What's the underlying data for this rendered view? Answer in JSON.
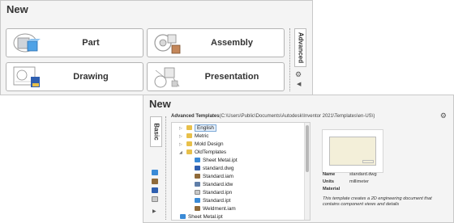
{
  "basic_panel": {
    "title": "New",
    "tiles": [
      {
        "label": "Part",
        "icon": "part-icon"
      },
      {
        "label": "Assembly",
        "icon": "assembly-icon"
      },
      {
        "label": "Drawing",
        "icon": "drawing-icon"
      },
      {
        "label": "Presentation",
        "icon": "presentation-icon"
      }
    ],
    "side_tab_label": "Advanced"
  },
  "advanced_panel": {
    "title": "New",
    "side_tab_label": "Basic",
    "templates_label": "Advanced Templates",
    "templates_path": "(C:\\Users\\Public\\Documents\\Autodesk\\Inventor 2021\\Templates\\en-US\\)",
    "tree": [
      {
        "label": "English",
        "type": "folder",
        "expander": "closed",
        "selected": true
      },
      {
        "label": "Metric",
        "type": "folder",
        "expander": "closed"
      },
      {
        "label": "Mold Design",
        "type": "folder",
        "expander": "closed"
      },
      {
        "label": "OldTemplates",
        "type": "folder",
        "expander": "open"
      },
      {
        "label": "Sheet Metal.ipt",
        "type": "ipt"
      },
      {
        "label": "standard.dwg",
        "type": "dwg"
      },
      {
        "label": "Standard.iam",
        "type": "iam"
      },
      {
        "label": "Standard.idw",
        "type": "idw"
      },
      {
        "label": "Standard.ipn",
        "type": "ipn"
      },
      {
        "label": "Standard.ipt",
        "type": "ipt"
      },
      {
        "label": "Weldment.iam",
        "type": "iam"
      },
      {
        "label": "Sheet Metal.ipt",
        "type": "ipt"
      }
    ],
    "details": {
      "name_label": "Name",
      "name_value": "standard.dwg",
      "units_label": "Units",
      "units_value": "millimeter",
      "material_label": "Material",
      "description": "This template creates a 2D engineering document that contains component views and details"
    }
  },
  "colors": {
    "panel_bg": "#f4f4f4",
    "folder": "#e8c04a",
    "ipt": "#3a8ad6",
    "iam": "#8f6a3a",
    "dwg": "#2f5fb0",
    "selection": "#7aa7d6"
  }
}
